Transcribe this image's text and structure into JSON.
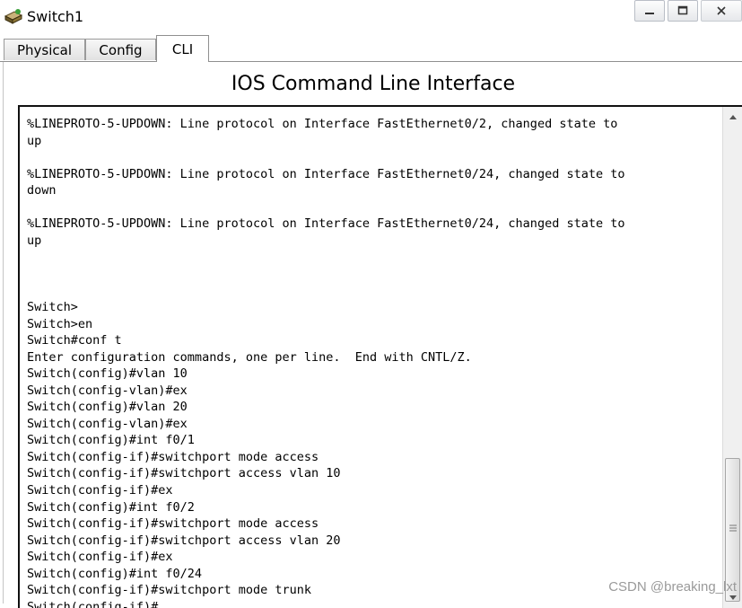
{
  "window": {
    "title": "Switch1",
    "controls": {
      "minimize": "—",
      "maximize": "□",
      "close": "✕"
    }
  },
  "tabs": [
    {
      "label": "Physical",
      "active": false
    },
    {
      "label": "Config",
      "active": false
    },
    {
      "label": "CLI",
      "active": true
    }
  ],
  "cli": {
    "heading": "IOS Command Line Interface",
    "output": "%LINEPROTO-5-UPDOWN: Line protocol on Interface FastEthernet0/2, changed state to\nup\n\n%LINEPROTO-5-UPDOWN: Line protocol on Interface FastEthernet0/24, changed state to\ndown\n\n%LINEPROTO-5-UPDOWN: Line protocol on Interface FastEthernet0/24, changed state to\nup\n\n\n\nSwitch>\nSwitch>en\nSwitch#conf t\nEnter configuration commands, one per line.  End with CNTL/Z.\nSwitch(config)#vlan 10\nSwitch(config-vlan)#ex\nSwitch(config)#vlan 20\nSwitch(config-vlan)#ex\nSwitch(config)#int f0/1\nSwitch(config-if)#switchport mode access\nSwitch(config-if)#switchport access vlan 10\nSwitch(config-if)#ex\nSwitch(config)#int f0/2\nSwitch(config-if)#switchport mode access\nSwitch(config-if)#switchport access vlan 20\nSwitch(config-if)#ex\nSwitch(config)#int f0/24\nSwitch(config-if)#switchport mode trunk\nSwitch(config-if)#"
  },
  "watermark": "CSDN @breaking_lxt",
  "icons": {
    "app": "switch-app-icon",
    "scroll_up": "scroll-up-arrow-icon",
    "scroll_down": "scroll-down-arrow-icon"
  }
}
